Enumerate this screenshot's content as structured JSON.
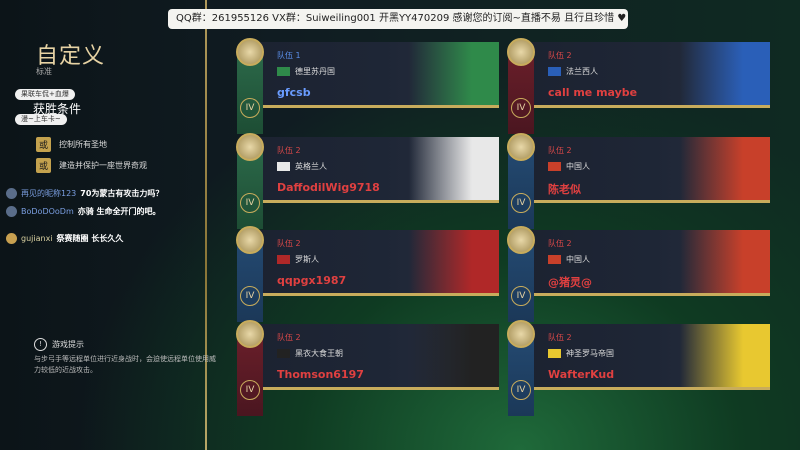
{
  "topbar": {
    "text": "QQ群：261955126  VX群：Suiweiling001  开黑YY470209  感谢您的订阅~直播不易 且行且珍惜 ♥"
  },
  "left": {
    "title": "自定义",
    "subtitle": "标准",
    "victory_title": "获胜条件",
    "conditions": [
      {
        "badge": "或",
        "text": "控制所有圣地"
      },
      {
        "badge": "或",
        "text": "建造并保护一座世界奇观"
      }
    ],
    "bubbles": [
      "果联车侃+血爆",
      "漫~上车卡~"
    ],
    "chat": [
      {
        "name": "再见的昵称123",
        "msg": "70为蒙古有攻击力吗？"
      },
      {
        "name": "BoDoDOoDm",
        "msg": "亦骑  生命全开门的吧。"
      },
      {
        "name": "gujianxi",
        "msg": "祭赛随圈  长长久久"
      }
    ],
    "tip_title": "游戏提示",
    "tip_body": "与步弓手等远程单位进行近身战时，会迫使远程单位使用威力较低的近战攻击。"
  },
  "cards": [
    {
      "team": "队伍 1",
      "civ": "德里苏丹国",
      "player": "gfcsb",
      "color": "blue",
      "flag": "#2f8a4a",
      "banner": "green"
    },
    {
      "team": "队伍 2",
      "civ": "法兰西人",
      "player": "call me  maybe",
      "color": "red",
      "flag": "#2a5fb8",
      "banner": "red"
    },
    {
      "team": "队伍 2",
      "civ": "英格兰人",
      "player": "DaffodilWig9718",
      "color": "red",
      "flag": "#e8e8e8",
      "banner": "green"
    },
    {
      "team": "队伍 2",
      "civ": "中国人",
      "player": "陈老似",
      "color": "red",
      "flag": "#c8402a",
      "banner": "blue"
    },
    {
      "team": "队伍 2",
      "civ": "罗斯人",
      "player": "qqpgx1987",
      "color": "red",
      "flag": "#b02828",
      "banner": "blue"
    },
    {
      "team": "队伍 2",
      "civ": "中国人",
      "player": "@猪灵@",
      "color": "red",
      "flag": "#c8402a",
      "banner": "blue"
    },
    {
      "team": "队伍 2",
      "civ": "黑衣大食王朝",
      "player": "Thomson6197",
      "color": "red",
      "flag": "#222222",
      "banner": "red"
    },
    {
      "team": "队伍 2",
      "civ": "神圣罗马帝国",
      "player": "WafterKud",
      "color": "red",
      "flag": "#e8c830",
      "banner": "blue"
    }
  ],
  "age_label": "IV"
}
